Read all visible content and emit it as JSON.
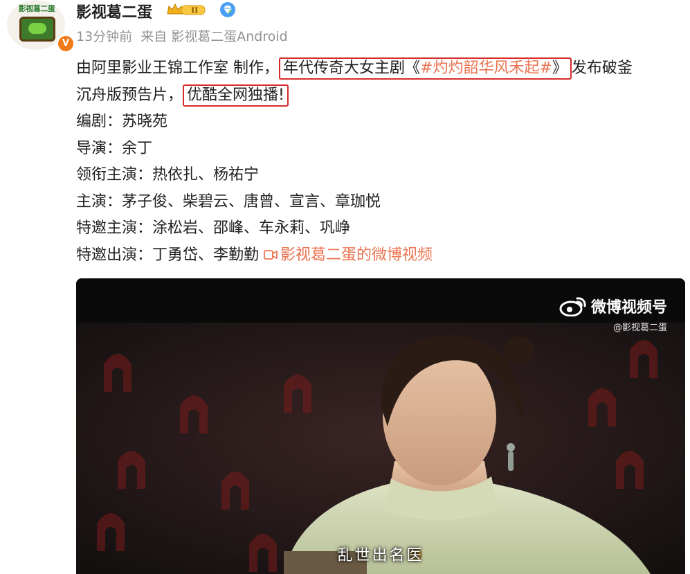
{
  "user": {
    "avatar_text": "影视葛二蛋",
    "name": "影视葛二蛋",
    "level_badge": "II",
    "verified_badge": "V"
  },
  "meta": {
    "time": "13分钟前",
    "source_prefix": "来自",
    "source": "影视葛二蛋Android"
  },
  "post": {
    "line1_prefix": "由阿里影业王锦工作室 制作，",
    "boxed1_prefix": "年代传奇大女主剧《",
    "hashtag": "#灼灼韶华风禾起#",
    "boxed1_suffix": "》",
    "line1_suffix": "发布破釜",
    "line2_prefix": "沉舟版预告片，",
    "boxed2": "优酷全网独播!",
    "writer_label": "编剧：",
    "writer": "苏晓苑",
    "director_label": "导演：",
    "director": "余丁",
    "lead_label": "领衔主演：",
    "lead": "热依扎、杨祐宁",
    "main_label": "主演：",
    "main": "茅子俊、柴碧云、唐曾、宣言、章珈悦",
    "special_label": "特邀主演：",
    "special": "涂松岩、邵峰、车永莉、巩峥",
    "guest_label": "特邀出演：",
    "guest": "丁勇岱、李勤勤",
    "video_link": "影视葛二蛋的微博视频"
  },
  "video": {
    "watermark_brand": "微博视频号",
    "watermark_handle": "@影视葛二蛋",
    "subtitle": "乱世出名医"
  },
  "colors": {
    "link": "#eb7350",
    "highlight_box": "#d62b2b",
    "meta": "#939393"
  }
}
